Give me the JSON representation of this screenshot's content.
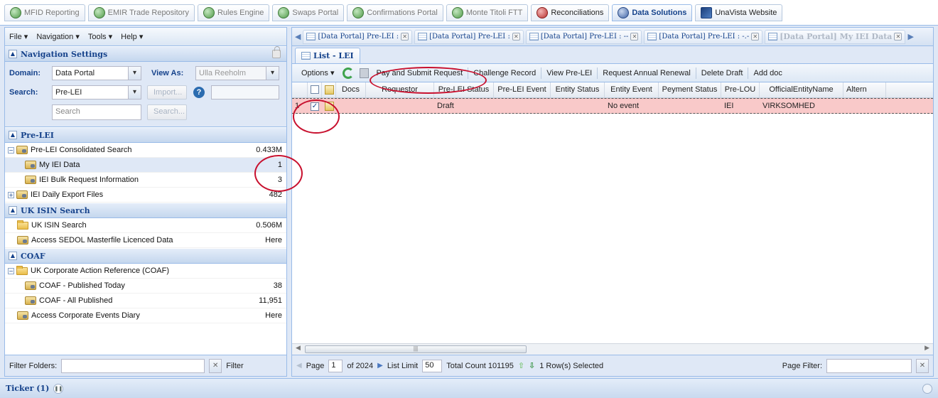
{
  "app_tabs": [
    {
      "label": "MFID Reporting",
      "icon": "green-globe-icon"
    },
    {
      "label": "EMIR Trade Repository",
      "icon": "green-globe-icon"
    },
    {
      "label": "Rules Engine",
      "icon": "green-globe-icon"
    },
    {
      "label": "Swaps Portal",
      "icon": "green-globe-icon"
    },
    {
      "label": "Confirmations Portal",
      "icon": "green-globe-icon"
    },
    {
      "label": "Monte Titoli FTT",
      "icon": "green-globe-icon"
    },
    {
      "label": "Reconciliations",
      "icon": "red-globe-icon"
    },
    {
      "label": "Data Solutions",
      "icon": "blue-globe-icon"
    },
    {
      "label": "UnaVista Website",
      "icon": "unavista-icon"
    }
  ],
  "menu": {
    "file": "File ▾",
    "navigation": "Navigation ▾",
    "tools": "Tools ▾",
    "help": "Help ▾"
  },
  "nav_settings": {
    "title": "Navigation Settings",
    "domain_label": "Domain:",
    "domain_value": "Data Portal",
    "view_as_label": "View As:",
    "view_as_value": "Ulla Reeholm",
    "search_label": "Search:",
    "search_value": "Pre-LEI",
    "import_label": "Import...",
    "search_placeholder": "Search",
    "search_button": "Search..."
  },
  "sections": {
    "pre_lei": {
      "title": "Pre-LEI",
      "items": [
        {
          "label": "Pre-LEI Consolidated Search",
          "count": "0.433M"
        },
        {
          "label": "My IEI Data",
          "count": "1"
        },
        {
          "label": "IEI Bulk Request Information",
          "count": "3"
        },
        {
          "label": "IEI Daily Export Files",
          "count": "482"
        }
      ]
    },
    "uk_isin": {
      "title": "UK ISIN Search",
      "items": [
        {
          "label": "UK ISIN Search",
          "count": "0.506M"
        },
        {
          "label": "Access SEDOL Masterfile Licenced Data",
          "count": "Here"
        }
      ]
    },
    "coaf": {
      "title": "COAF",
      "items": [
        {
          "label": "UK Corporate Action Reference (COAF)",
          "count": ""
        },
        {
          "label": "COAF - Published Today",
          "count": "38"
        },
        {
          "label": "COAF - All Published",
          "count": "11,951"
        },
        {
          "label": "Access Corporate Events Diary",
          "count": "Here"
        }
      ]
    }
  },
  "filter": {
    "label": "Filter Folders:",
    "button": "Filter"
  },
  "doc_tabs": [
    "[Data Portal] Pre-LEI :",
    "[Data Portal] Pre-LEI :",
    "[Data Portal] Pre-LEI : --",
    "[Data Portal] Pre-LEI : -.-",
    "[Data Portal] My IEI Data"
  ],
  "list_tab": "List - LEI",
  "toolbar": {
    "options": "Options ▾",
    "pay_submit": "Pay and Submit Request",
    "challenge": "Challenge Record",
    "view_pre_lei": "View Pre-LEI",
    "annual_renewal": "Request Annual Renewal",
    "delete_draft": "Delete Draft",
    "add_doc": "Add doc"
  },
  "grid": {
    "columns": [
      "Docs",
      "Requestor",
      "Pre-LEI Status",
      "Pre-LEI Event",
      "Entity Status",
      "Entity Event",
      "Peyment Status",
      "Pre-LOU",
      "OfficialEntityName",
      "Altern"
    ],
    "rows": [
      {
        "num": "1",
        "checked": "✓",
        "docs": "",
        "requestor": "",
        "pre_lei_status": "Draft",
        "pre_lei_event": "",
        "entity_status": "",
        "entity_event": "No event",
        "payment_status": "",
        "pre_lou": "IEI",
        "official_name": "VIRKSOMHED",
        "altern": ""
      }
    ]
  },
  "pager": {
    "page_label": "Page",
    "page": "1",
    "of": "of 2024",
    "list_limit_label": "List Limit",
    "list_limit": "50",
    "total": "Total Count 101195",
    "selected": "1 Row(s) Selected",
    "page_filter_label": "Page Filter:"
  },
  "ticker": {
    "label": "Ticker (1)"
  },
  "colors": {
    "panel_header": "#15428b",
    "selected_row": "#f9c9c9",
    "annotation": "#c8102e"
  }
}
